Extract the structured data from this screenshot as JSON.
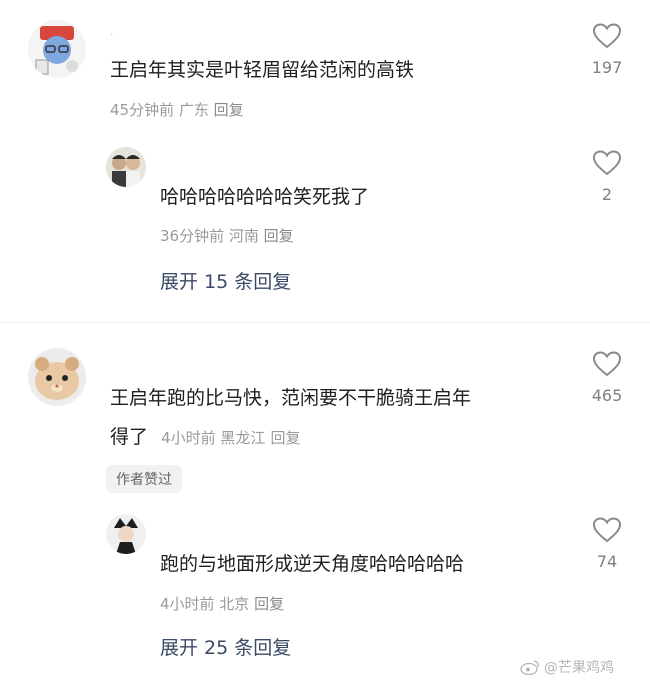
{
  "comments": [
    {
      "username": "·",
      "text": "王启年其实是叶轻眉留给范闲的高铁",
      "meta": "45分钟前 广东",
      "reply_label": "回复",
      "likes": "197",
      "reply": {
        "username": "",
        "text": "哈哈哈哈哈哈哈笑死我了",
        "meta": "36分钟前 河南",
        "reply_label": "回复",
        "likes": "2"
      },
      "expand_label": "展开 15 条回复"
    },
    {
      "username": "",
      "text_line1": "王启年跑的比马快，范闲要不干脆骑王启年",
      "text_line2": "得了",
      "meta": "4小时前 黑龙江",
      "reply_label": "回复",
      "likes": "465",
      "badge": "作者赞过",
      "reply": {
        "username": "",
        "text": "跑的与地面形成逆天角度哈哈哈哈哈",
        "meta": "4小时前 北京",
        "reply_label": "回复",
        "likes": "74"
      },
      "expand_label": "展开 25 条回复"
    }
  ],
  "watermark": "@芒果鸡鸡",
  "colors": {
    "link": "#3a4a66",
    "meta": "#9a9a9a",
    "divider": "#efefef"
  },
  "icons": {
    "like": "heart-outline-icon",
    "weibo": "weibo-icon"
  }
}
